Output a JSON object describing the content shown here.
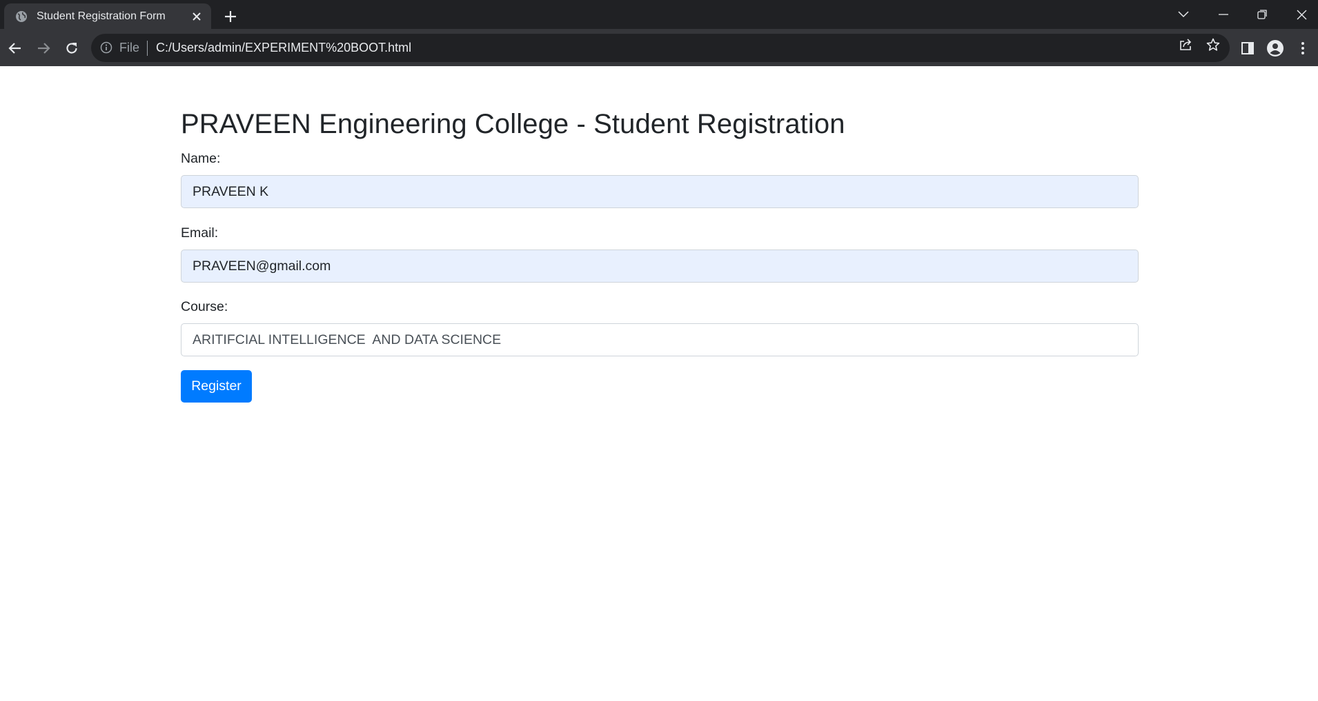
{
  "browser": {
    "tab_title": "Student Registration Form",
    "url_scheme_label": "File",
    "url": "C:/Users/admin/EXPERIMENT%20BOOT.html"
  },
  "page": {
    "title": "PRAVEEN Engineering College - Student Registration",
    "form": {
      "name_label": "Name:",
      "name_value": "PRAVEEN K",
      "email_label": "Email:",
      "email_value": "PRAVEEN@gmail.com",
      "course_label": "Course:",
      "course_value": "ARITIFCIAL INTELLIGENCE  AND DATA SCIENCE",
      "submit_label": "Register"
    }
  },
  "colors": {
    "chrome_dark": "#202124",
    "chrome_toolbar": "#35363a",
    "autofill_bg": "#e8f0fe",
    "primary_button": "#007bff",
    "text": "#212529"
  },
  "icons": [
    "globe-icon",
    "close-icon",
    "plus-icon",
    "chevron-down-icon",
    "minimize-icon",
    "restore-icon",
    "back-icon",
    "forward-icon",
    "reload-icon",
    "info-icon",
    "share-icon",
    "star-icon",
    "side-panel-icon",
    "profile-icon",
    "more-vert-icon"
  ]
}
